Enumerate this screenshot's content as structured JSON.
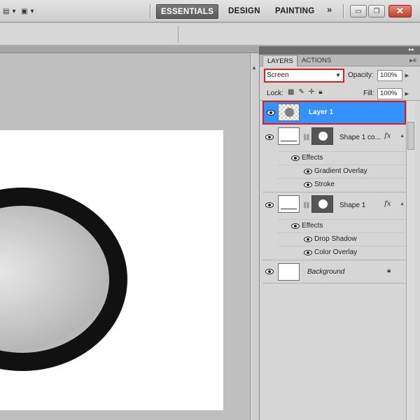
{
  "workspace": {
    "buttons": [
      {
        "label": "ESSENTIALS",
        "active": true
      },
      {
        "label": "DESIGN",
        "active": false
      },
      {
        "label": "PAINTING",
        "active": false
      }
    ],
    "more": "»"
  },
  "window_controls": {
    "minimize": "▭",
    "restore": "❐",
    "close": "✕"
  },
  "panel": {
    "tabs": [
      "LAYERS",
      "ACTIONS"
    ],
    "blend_mode": "Screen",
    "opacity_label": "Opacity:",
    "opacity_value": "100%",
    "lock_label": "Lock:",
    "fill_label": "Fill:",
    "fill_value": "100%"
  },
  "layers": [
    {
      "name": "Layer 1",
      "selected": true
    },
    {
      "name": "Shape 1 co...",
      "fx": "fx",
      "effects_label": "Effects",
      "effects": [
        "Gradient Overlay",
        "Stroke"
      ]
    },
    {
      "name": "Shape 1",
      "fx": "fx",
      "effects_label": "Effects",
      "effects": [
        "Drop Shadow",
        "Color Overlay"
      ]
    },
    {
      "name": "Background",
      "locked": true
    }
  ],
  "colors": {
    "selection": "#3392ff",
    "highlight": "#d41f2a",
    "ring": "#111111"
  }
}
